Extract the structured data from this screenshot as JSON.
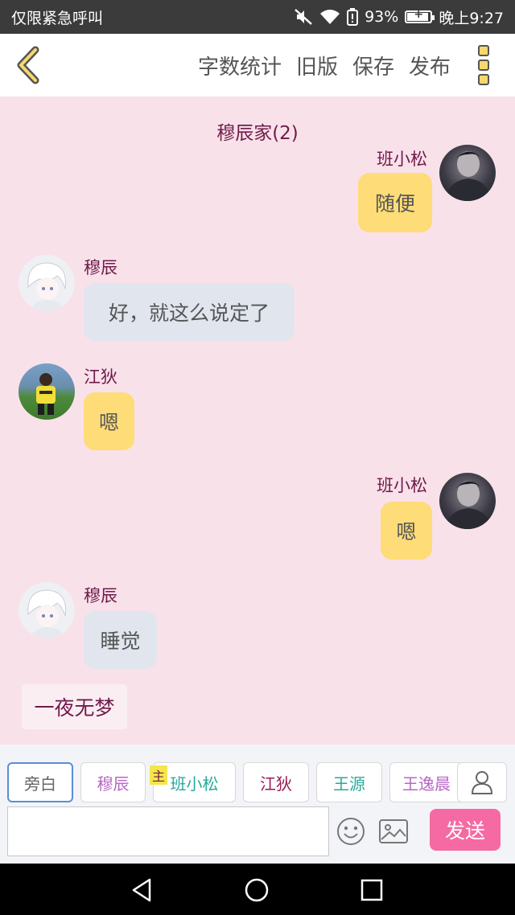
{
  "status_bar": {
    "carrier_text": "仅限紧急呼叫",
    "battery_percent": "93%",
    "battery_level": 0.93,
    "time": "晚上9:27",
    "icons": [
      "mute-icon",
      "wifi-icon",
      "battery-alert-icon",
      "battery-icon"
    ]
  },
  "toolbar": {
    "back_icon": "chevron-left-icon",
    "menu": [
      "字数统计",
      "旧版",
      "保存",
      "发布"
    ],
    "more_icon": "more-vertical-icon"
  },
  "chat": {
    "title": "穆辰家(2)",
    "messages": [
      {
        "side": "right",
        "name": "班小松",
        "text": "随便",
        "color": "yellow"
      },
      {
        "side": "left",
        "name": "穆辰",
        "text": "好，就这么说定了",
        "color": "gray"
      },
      {
        "side": "left",
        "name": "江狄",
        "text": "嗯",
        "color": "yellow"
      },
      {
        "side": "right",
        "name": "班小松",
        "text": "嗯",
        "color": "yellow"
      },
      {
        "side": "left",
        "name": "穆辰",
        "text": "睡觉",
        "color": "gray"
      }
    ],
    "narration": "一夜无梦"
  },
  "characters": {
    "main_tag": "主",
    "items": [
      {
        "label": "旁白",
        "color": "#666666",
        "selected": true
      },
      {
        "label": "穆辰",
        "color": "#b667c4"
      },
      {
        "label": "班小松",
        "color": "#2aa99b"
      },
      {
        "label": "江狄",
        "color": "#9b1a56"
      },
      {
        "label": "王源",
        "color": "#2aa99b"
      },
      {
        "label": "王逸晨",
        "color": "#b667c4"
      }
    ],
    "user_icon": "user-icon"
  },
  "input": {
    "placeholder": "",
    "value": "",
    "emoji_icon": "emoji-icon",
    "image_icon": "image-icon",
    "send_label": "发送"
  },
  "colors": {
    "chat_bg": "#f9e1ea",
    "bubble_yellow": "#fedc78",
    "bubble_gray": "#e0e5ee",
    "name_text": "#6f1b4a",
    "send_button": "#f56aa3"
  }
}
